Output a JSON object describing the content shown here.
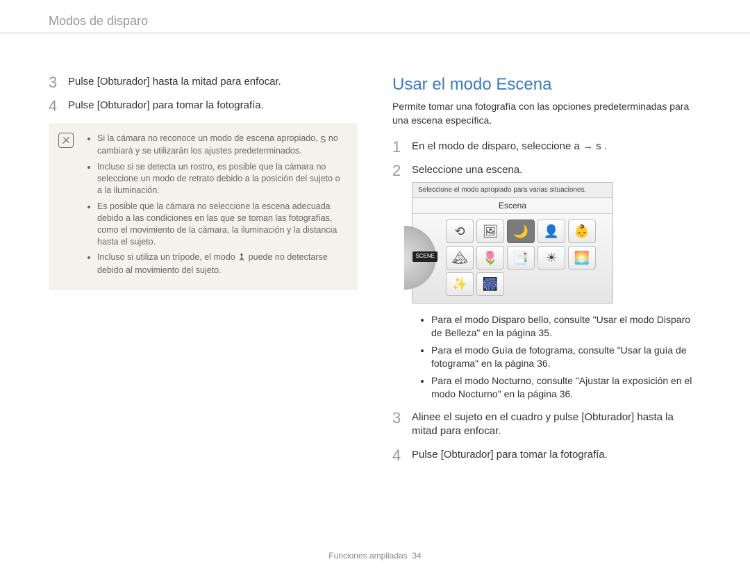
{
  "header": {
    "breadcrumb": "Modos de disparo"
  },
  "left": {
    "step3": "Pulse [Obturador] hasta la mitad para enfocar.",
    "step4": "Pulse [Obturador] para tomar la fotografía.",
    "notes": {
      "n1a": "Si la cámara no reconoce un modo de escena apropiado, ",
      "n1_icon": "S",
      "n1b": " no cambiará y se utilizarán los ajustes predeterminados.",
      "n2": "Incluso si se detecta un rostro, es posible que la cámara no seleccione un modo de retrato debido a la posición del sujeto o a la iluminación.",
      "n3": "Es posible que la cámara no seleccione la escena adecuada debido a las condiciones en las que se toman las fotografías, como el movimiento de la cámara, la iluminación y la distancia hasta el sujeto.",
      "n4a": "Incluso si utiliza un trípode, el modo ",
      "n4b": " puede no detectarse debido al movimiento del sujeto."
    }
  },
  "right": {
    "title": "Usar el modo Escena",
    "intro": "Permite tomar una fotografía con las opciones predeterminadas para una escena específica.",
    "step1a": "En el modo de disparo, seleccione a  ",
    "step1_arrow": "→",
    "step1b": " s  .",
    "step2": "Seleccione una escena.",
    "screen": {
      "hint": "Seleccione el modo apropiado para varias situaciones.",
      "title": "Escena",
      "dial_badge": "SCENE",
      "tiles": [
        "⟲",
        "🖼",
        "🌙",
        "👤",
        "👶",
        "🏔",
        "🌷",
        "📑",
        "☀",
        "🌅",
        "✨",
        "🎆"
      ]
    },
    "sub": {
      "b1": "Para el modo Disparo bello, consulte \"Usar el modo Disparo de Belleza\" en la página 35.",
      "b2": "Para el modo Guía de fotograma, consulte \"Usar la guía de fotograma\" en la página 36.",
      "b3": "Para el modo Nocturno, consulte \"Ajustar la exposición en el modo Nocturno\" en la página 36."
    },
    "step3": "Alinee el sujeto en el cuadro y pulse [Obturador] hasta la mitad para enfocar.",
    "step4": "Pulse [Obturador] para tomar la fotografía."
  },
  "footer": {
    "section": "Funciones ampliadas",
    "page": "34"
  }
}
